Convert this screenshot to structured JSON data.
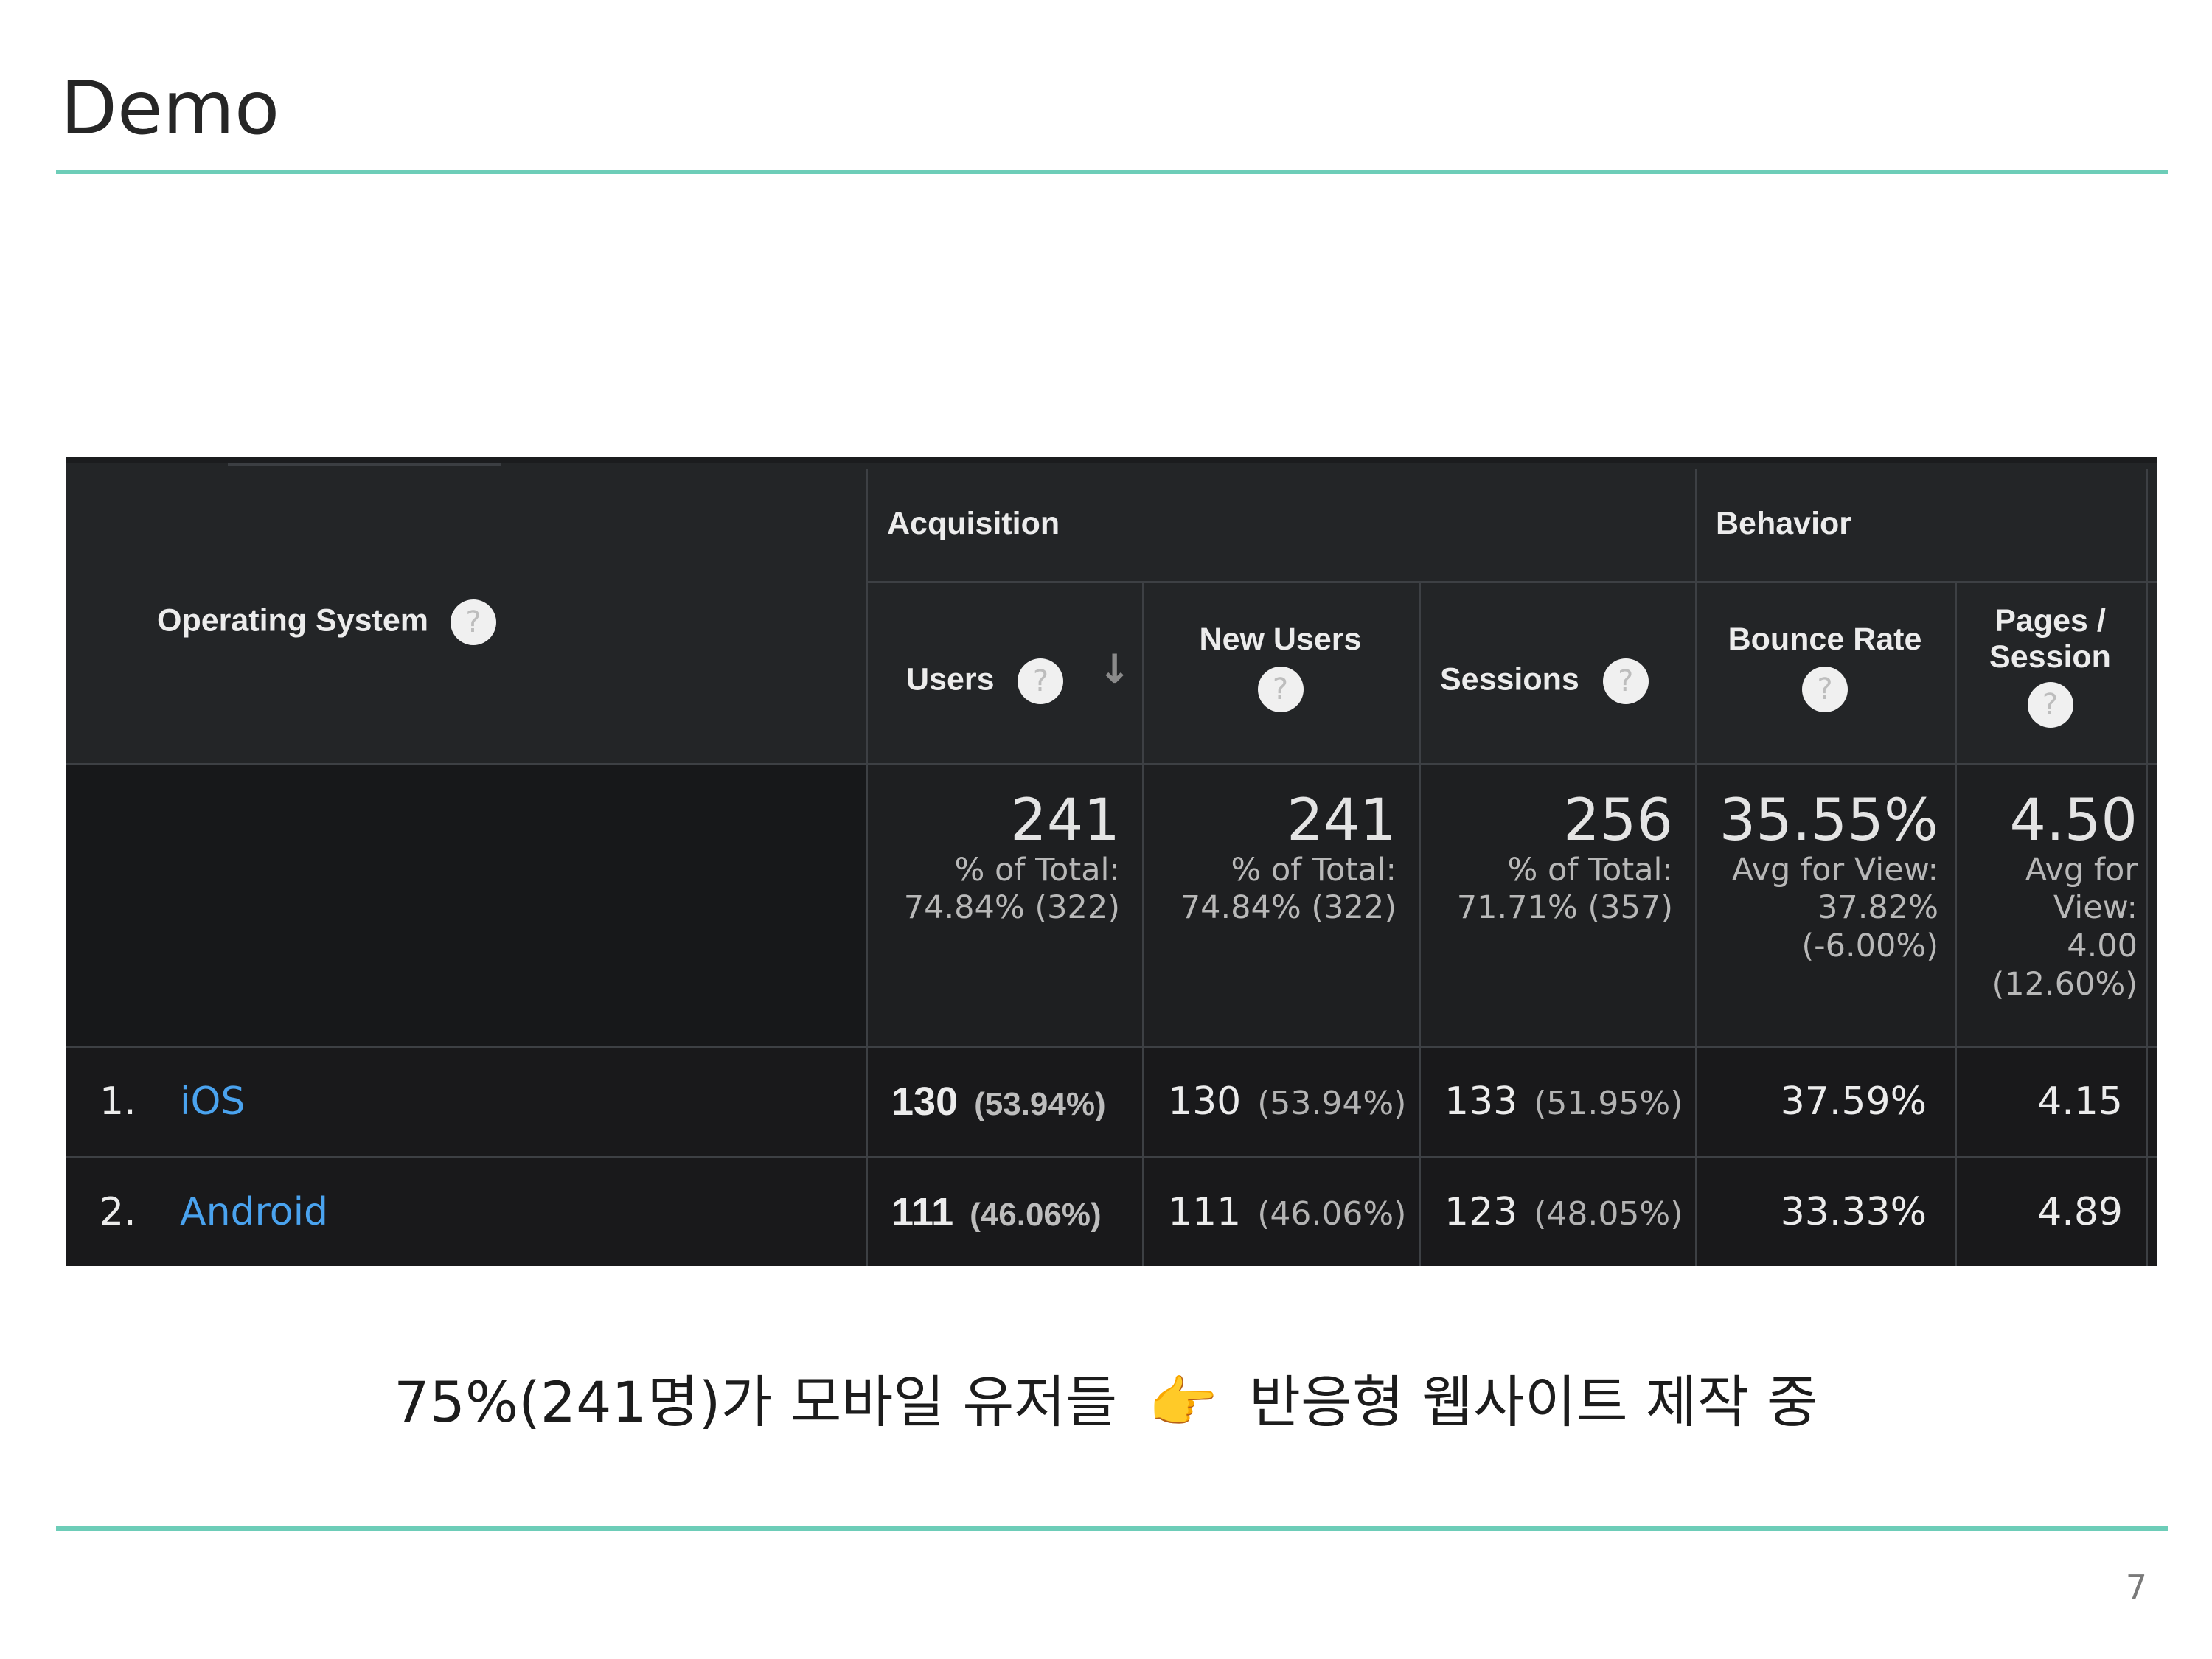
{
  "slide": {
    "title": "Demo",
    "caption_text": "75%(241명)가 모바일 유저들",
    "caption_pointer": "👉",
    "caption_conclusion": "반응형 웹사이트 제작 중",
    "page_number": "7",
    "accent_color": "#6dcdb8"
  },
  "report": {
    "dimension_header": "Operating System",
    "groups": {
      "acquisition": "Acquisition",
      "behavior": "Behavior"
    },
    "columns": {
      "users": "Users",
      "new_users": "New Users",
      "sessions": "Sessions",
      "bounce_rate": "Bounce Rate",
      "pages_session_line1": "Pages /",
      "pages_session_line2": "Session"
    },
    "help_icon": "?",
    "sort_icon": "↓",
    "totals": {
      "users": {
        "value": "241",
        "line1": "% of Total:",
        "line2": "74.84% (322)"
      },
      "new_users": {
        "value": "241",
        "line1": "% of Total:",
        "line2": "74.84% (322)"
      },
      "sessions": {
        "value": "256",
        "line1": "% of Total:",
        "line2": "71.71% (357)"
      },
      "bounce_rate": {
        "value": "35.55%",
        "line1": "Avg for View:",
        "line2": "37.82%",
        "line3": "(-6.00%)"
      },
      "pages_session": {
        "value": "4.50",
        "line1": "Avg for",
        "line2": "View:",
        "line3": "4.00",
        "line4": "(12.60%)"
      }
    },
    "rows": [
      {
        "index": "1.",
        "os": "iOS",
        "users": "130",
        "users_pct": "(53.94%)",
        "new_users": "130",
        "new_users_pct": "(53.94%)",
        "sessions": "133",
        "sessions_pct": "(51.95%)",
        "bounce_rate": "37.59%",
        "pages_session": "4.15"
      },
      {
        "index": "2.",
        "os": "Android",
        "users": "111",
        "users_pct": "(46.06%)",
        "new_users": "111",
        "new_users_pct": "(46.06%)",
        "sessions": "123",
        "sessions_pct": "(48.05%)",
        "bounce_rate": "33.33%",
        "pages_session": "4.89"
      }
    ],
    "link_color": "#4aa3ef"
  }
}
